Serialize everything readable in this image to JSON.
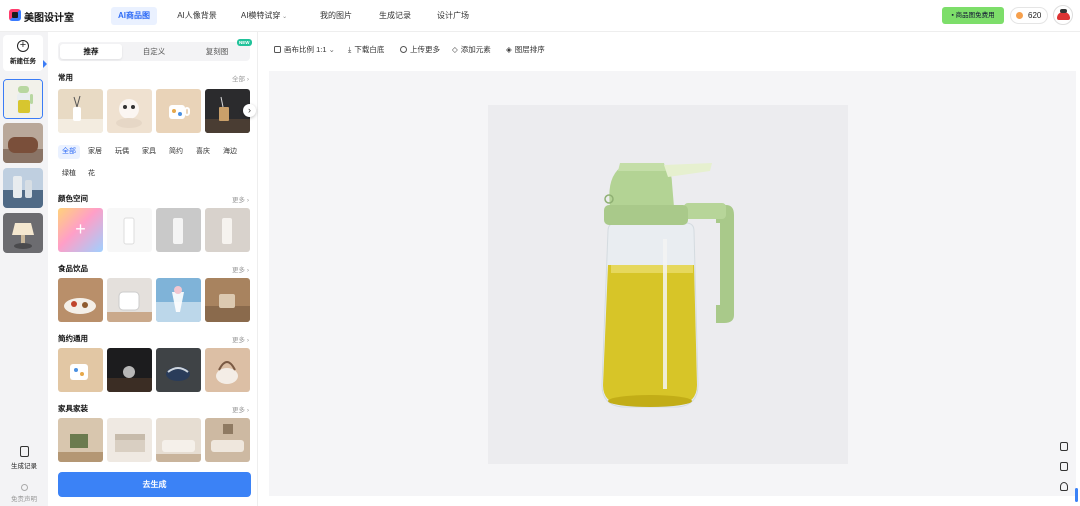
{
  "app": {
    "brand": "美图设计室"
  },
  "nav": [
    {
      "label": "AI商品图",
      "active": true
    },
    {
      "label": "AI人像背景"
    },
    {
      "label": "AI模特试穿",
      "dropdown": true
    },
    {
      "label": "我的图片"
    },
    {
      "label": "生成记录"
    },
    {
      "label": "设计广场"
    }
  ],
  "header": {
    "promo": "商品图免费用",
    "coins": "620"
  },
  "rail": {
    "new_task": "新建任务",
    "history": "生成记录",
    "disclaimer": "免责声明"
  },
  "panel": {
    "tabs": [
      {
        "label": "推荐",
        "active": true
      },
      {
        "label": "自定义"
      },
      {
        "label": "复刻图",
        "badge": "NEW"
      }
    ],
    "sections": [
      {
        "title": "常用",
        "more": "全部 ›"
      },
      {
        "title": "颜色空间",
        "more": "更多 ›"
      },
      {
        "title": "食品饮品",
        "more": "更多 ›"
      },
      {
        "title": "简约通用",
        "more": "更多 ›"
      },
      {
        "title": "家具家装",
        "more": "更多 ›"
      }
    ],
    "chips": [
      "全部",
      "家居",
      "玩偶",
      "家具",
      "简约",
      "喜庆",
      "海边",
      "绿植",
      "花"
    ],
    "generate": "去生成"
  },
  "toolbar": {
    "ratio": "画布比例 1:1",
    "download": "下载白底",
    "upload": "上传更多",
    "add": "添加元素",
    "layers": "图层排序"
  },
  "colors": {
    "accent": "#3b82f6",
    "promo": "#7dde6a",
    "canvas_bg": "#f5f5f7"
  }
}
